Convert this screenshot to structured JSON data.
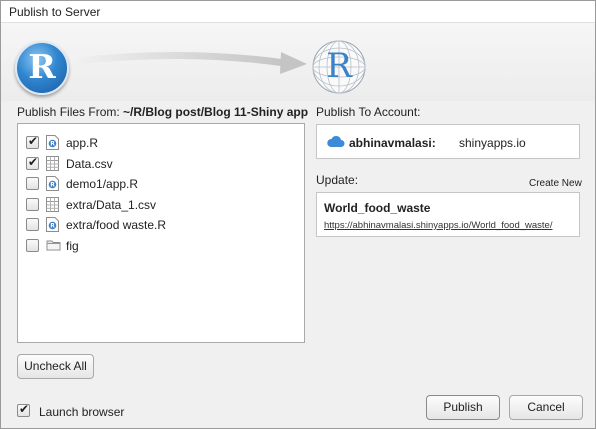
{
  "window": {
    "title": "Publish to Server"
  },
  "source": {
    "logo_letter": "R",
    "publish_from_label": "Publish Files From:",
    "publish_from_path": "~/R/Blog post/Blog 11-Shiny app"
  },
  "files": [
    {
      "name": "app.R",
      "checked": true,
      "icon": "r-file-icon"
    },
    {
      "name": "Data.csv",
      "checked": true,
      "icon": "csv-file-icon"
    },
    {
      "name": "demo1/app.R",
      "checked": false,
      "icon": "r-file-icon"
    },
    {
      "name": "extra/Data_1.csv",
      "checked": false,
      "icon": "csv-file-icon"
    },
    {
      "name": "extra/food waste.R",
      "checked": false,
      "icon": "r-file-icon"
    },
    {
      "name": "fig",
      "checked": false,
      "icon": "folder-icon"
    }
  ],
  "target": {
    "logo_letter": "R",
    "publish_to_label": "Publish To Account:",
    "account_name": "abhinavmalasi:",
    "account_server": "shinyapps.io",
    "update_label": "Update:",
    "create_new_label": "Create New",
    "app_name": "World_food_waste",
    "app_url": "https://abhinavmalasi.shinyapps.io/World_food_waste/"
  },
  "buttons": {
    "uncheck_all": "Uncheck All",
    "publish": "Publish",
    "cancel": "Cancel"
  },
  "options": {
    "launch_browser_label": "Launch browser",
    "launch_browser_checked": true
  },
  "colors": {
    "accent_blue": "#2f86cf",
    "cloud_blue": "#3d8ad8"
  }
}
